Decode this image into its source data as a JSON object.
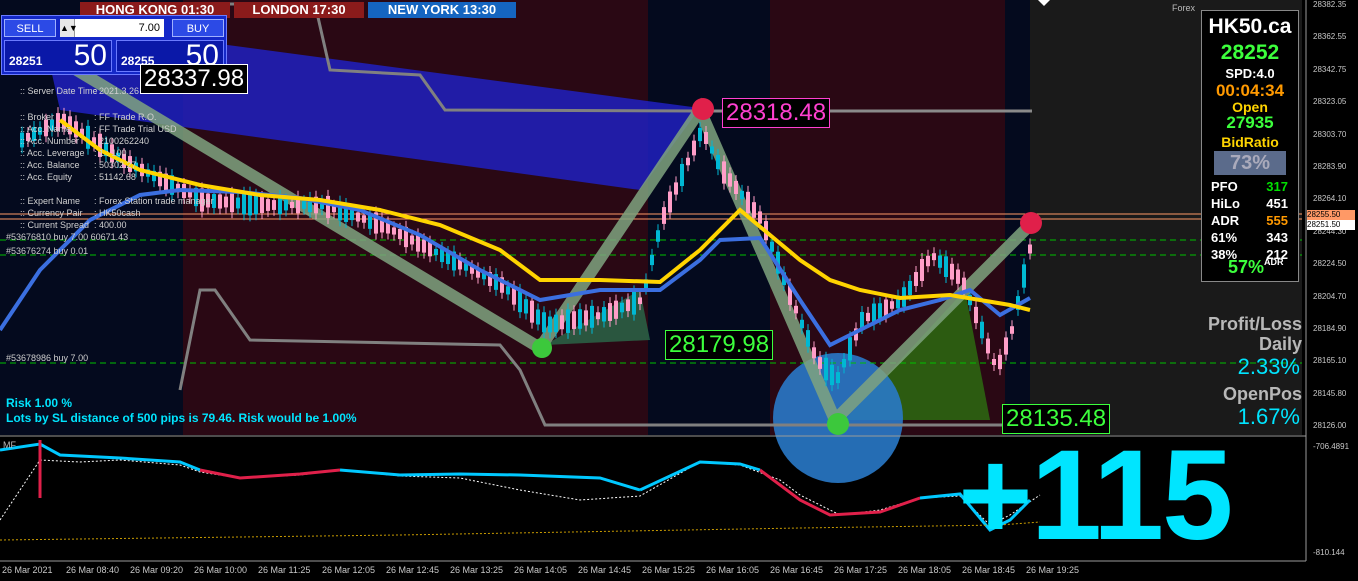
{
  "sessions": [
    {
      "label": "HONG KONG 01:30",
      "bg": "#8b1b1b"
    },
    {
      "label": "LONDON  17:30",
      "bg": "#8b1b1b"
    },
    {
      "label": "NEW YORK 13:30",
      "bg": "#1565c0"
    }
  ],
  "trade": {
    "sell_label": "SELL",
    "buy_label": "BUY",
    "lot": "7.00",
    "spin": "▲▼",
    "bid_small": "28251",
    "bid_big": "50",
    "ask_small": "28255",
    "ask_big": "50"
  },
  "price_labels": {
    "high_left": "28337.98",
    "peak": "28318.48",
    "mid_low": "28179.98",
    "low": "28135.48"
  },
  "account_info": [
    {
      "k": ":: Server Date Time",
      "v": ": 2021.3.26 - 19:30:24"
    },
    {
      "k": ":: Broker",
      "v": ": FF Trade R.O."
    },
    {
      "k": ":: Acc. Name",
      "v": ": FF Trade Trial USD"
    },
    {
      "k": ":: Acc. Number",
      "v": ": 2100262240"
    },
    {
      "k": ":: Acc. Leverage",
      "v": ": 1 : 100"
    },
    {
      "k": ":: Acc. Balance",
      "v": ": 50302.27"
    },
    {
      "k": ":: Acc. Equity",
      "v": ": 51142.68"
    },
    {
      "k": ":: Expert Name",
      "v": ": Forex Station trade manager"
    },
    {
      "k": ":: Currency Pair",
      "v": ": HK50cash"
    },
    {
      "k": ":: Current Spread",
      "v": ": 400.00"
    }
  ],
  "order_lines": [
    "#53676810 buy 7.00 60671.43",
    "#53676274 buy 0.01",
    "#53678986 buy 7.00"
  ],
  "risk_lines": [
    "Risk 1.00 %",
    "Lots by SL distance of 500 pips is 79.46. Risk would be 1.00%"
  ],
  "corner_label": "Forex",
  "panel": {
    "symbol": "HK50.ca",
    "price": "28252",
    "spread": "SPD:4.0",
    "timer": "00:04:34",
    "open_label": "Open",
    "open_value": "27935",
    "bidratio_label": "BidRatio",
    "bidratio": "73%",
    "stats": [
      {
        "k": "PFO",
        "v": "317",
        "c": "#00e000"
      },
      {
        "k": "HiLo",
        "v": "451",
        "c": "#ffffff"
      },
      {
        "k": "ADR",
        "v": "555",
        "c": "#ff9900"
      },
      {
        "k": "61%",
        "v": "343",
        "c": "#ffffff"
      },
      {
        "k": "38%",
        "v": "212",
        "c": "#ffffff"
      }
    ],
    "adr_pct": "57%",
    "adr_suffix": "ADR"
  },
  "pnl": {
    "title1": "Profit/Loss",
    "title2": "Daily",
    "daily": "2.33%",
    "openpos_label": "OpenPos",
    "openpos": "1.67%"
  },
  "big_number": "+115",
  "mf_label": "MF",
  "price_axis": [
    "28382.35",
    "28362.55",
    "28342.75",
    "28323.05",
    "28303.70",
    "28283.90",
    "28264.10",
    "28244.30",
    "28224.50",
    "28204.70",
    "28184.90",
    "28165.10",
    "28145.80",
    "28126.00"
  ],
  "current_prices": [
    "28255.50",
    "28251.50"
  ],
  "osc_axis": [
    "-706.4891",
    "-810.144"
  ],
  "time_axis": [
    "26 Mar 2021",
    "26 Mar 08:40",
    "26 Mar 09:20",
    "26 Mar 10:00",
    "26 Mar 11:25",
    "26 Mar 12:05",
    "26 Mar 12:45",
    "26 Mar 13:25",
    "26 Mar 14:05",
    "26 Mar 14:45",
    "26 Mar 15:25",
    "26 Mar 16:05",
    "26 Mar 16:45",
    "26 Mar 17:25",
    "26 Mar 18:05",
    "26 Mar 18:45",
    "26 Mar 19:25"
  ],
  "colors": {
    "bull": "#00b8d4",
    "bear": "#ff9ec8",
    "ema_fast": "#ffd400",
    "ema_slow": "#3b6fe0",
    "zigzag": "#7fa37f",
    "accent": "#00e5ff"
  }
}
